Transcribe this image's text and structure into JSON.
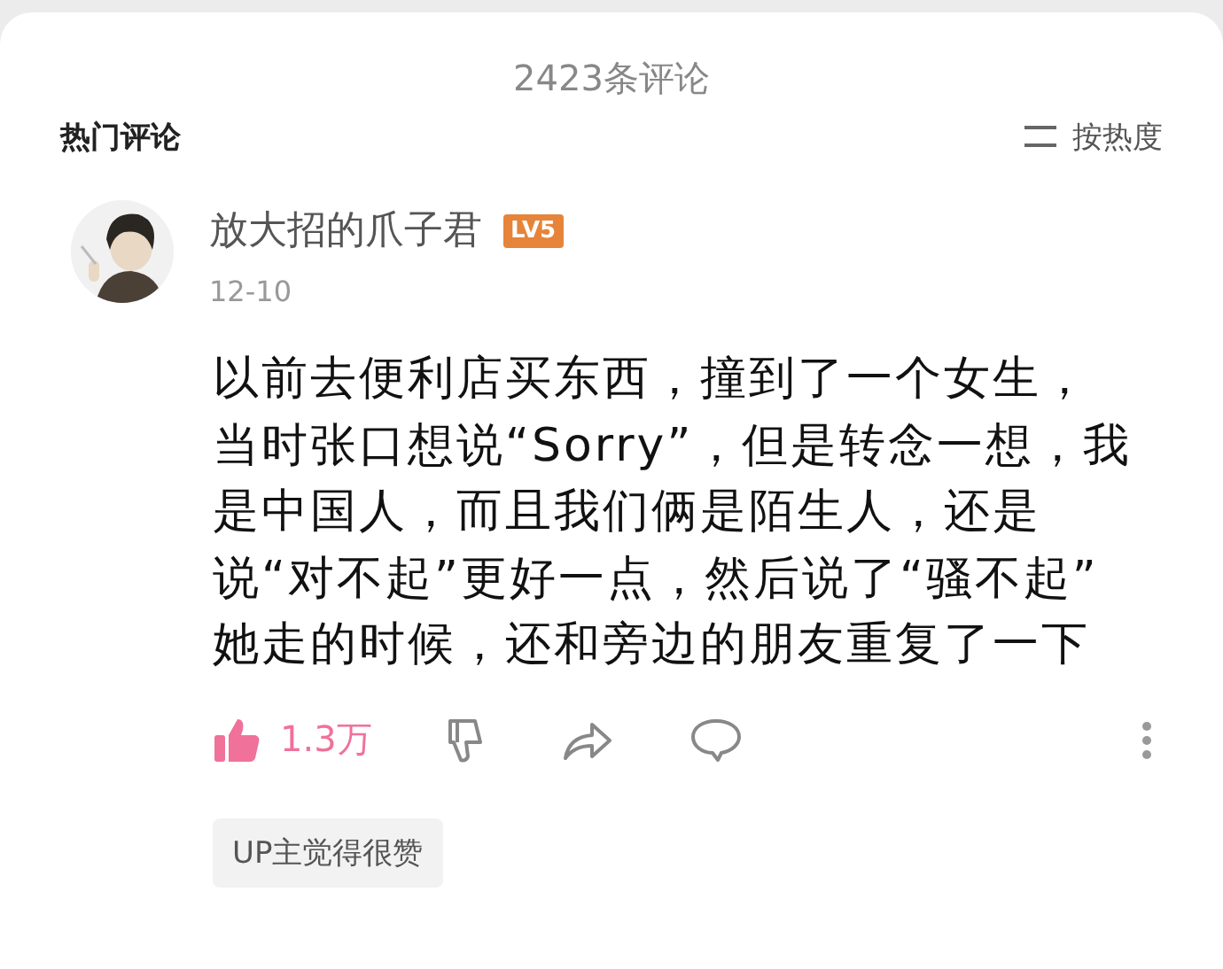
{
  "header": {
    "title": "2423条评论"
  },
  "section": {
    "title": "热门评论",
    "sort_label": "按热度"
  },
  "comment": {
    "user": "放大招的爪子君",
    "level_badge": "LV5",
    "date": "12-10",
    "text_lines": [
      "以前去便利店买东西，撞到了一个女生，",
      "当时张口想说“Sorry”，但是转念一想，我",
      "是中国人，而且我们俩是陌生人，还是",
      "说“对不起”更好一点，然后说了“骚不起”",
      "她走的时候，还和旁边的朋友重复了一下"
    ],
    "liked": true,
    "like_count": "1.3万",
    "tag": "UP主觉得很赞"
  }
}
